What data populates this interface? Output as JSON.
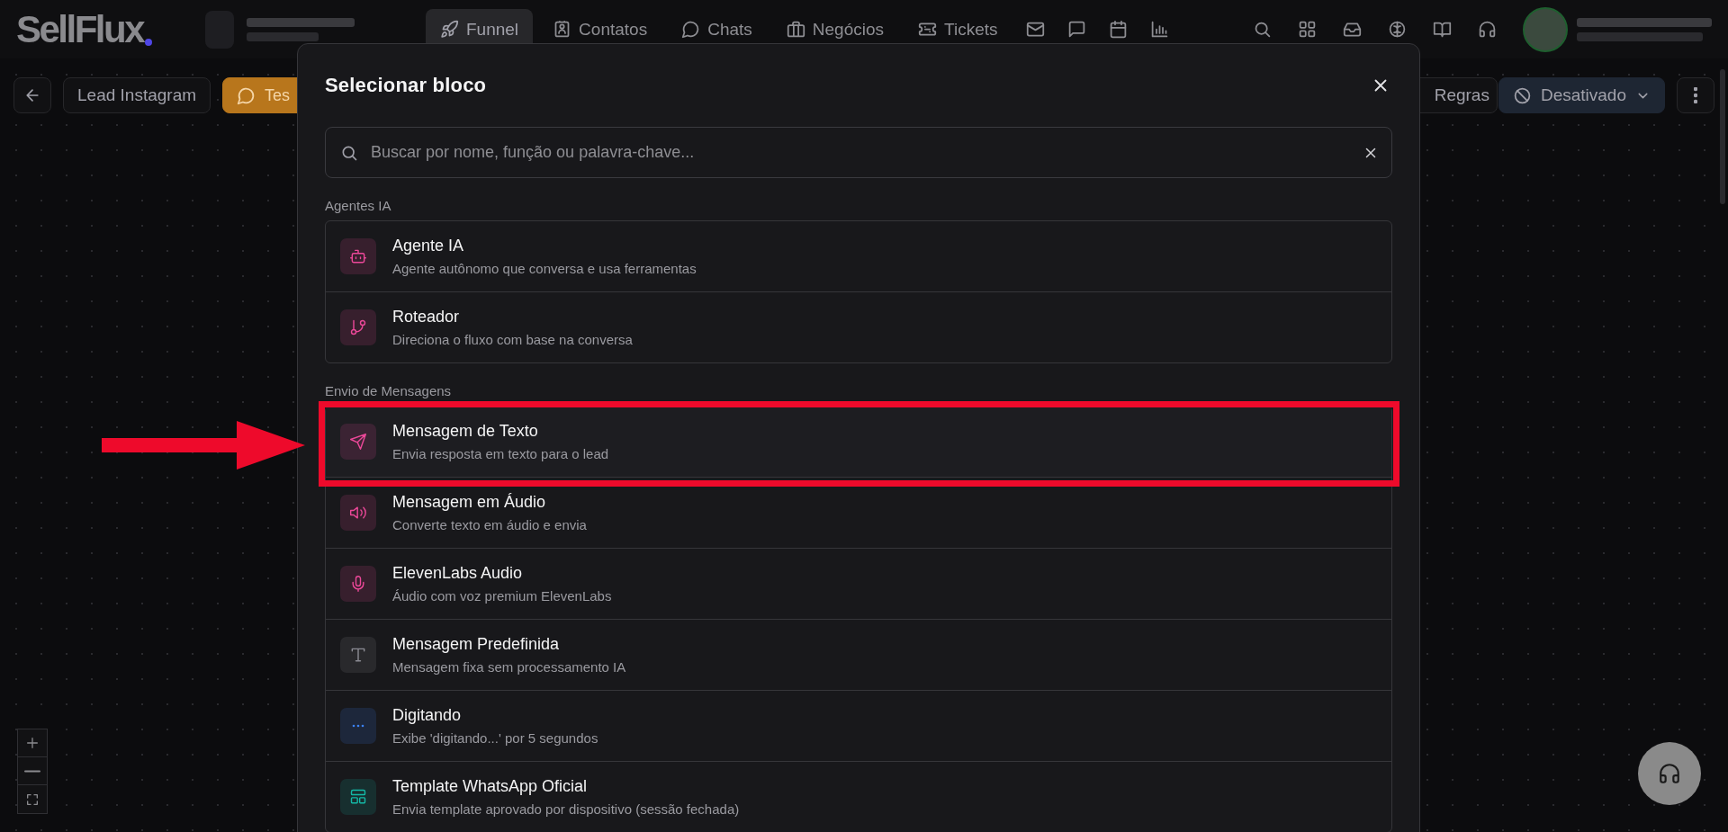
{
  "logo": {
    "text": "SellFlux"
  },
  "nav": [
    {
      "label": "Funnel",
      "kind": "rocket",
      "selected": true
    },
    {
      "label": "Contatos",
      "kind": "contact",
      "selected": false
    },
    {
      "label": "Chats",
      "kind": "chat",
      "selected": false
    },
    {
      "label": "Negócios",
      "kind": "briefcase",
      "selected": false
    },
    {
      "label": "Tickets",
      "kind": "ticket",
      "selected": false
    }
  ],
  "toolbar": {
    "flow_name": "Lead Instagram",
    "test_label": "Tes",
    "rules": "Regras",
    "status": "Desativado"
  },
  "modal": {
    "title": "Selecionar bloco",
    "search_placeholder": "Buscar por nome, função ou palavra-chave...",
    "groups": [
      {
        "label": "Agentes IA",
        "items": [
          {
            "title": "Agente IA",
            "description": "Agente autônomo que conversa e usa ferramentas",
            "kind": "robot",
            "color": "#ec4899",
            "selected": false
          },
          {
            "title": "Roteador",
            "description": "Direciona o fluxo com base na conversa",
            "kind": "branch",
            "color": "#ec4899",
            "selected": false
          }
        ]
      },
      {
        "label": "Envio de Mensagens",
        "items": [
          {
            "title": "Mensagem de Texto",
            "description": "Envia resposta em texto para o lead",
            "kind": "send",
            "color": "#ec4899",
            "selected": true
          },
          {
            "title": "Mensagem em Áudio",
            "description": "Converte texto em áudio e envia",
            "kind": "speaker",
            "color": "#ec4899",
            "selected": false
          },
          {
            "title": "ElevenLabs Audio",
            "description": "Áudio com voz premium ElevenLabs",
            "kind": "mic",
            "color": "#ec4899",
            "selected": false
          },
          {
            "title": "Mensagem Predefinida",
            "description": "Mensagem fixa sem processamento IA",
            "kind": "text",
            "color": "#8b8b93",
            "selected": false
          },
          {
            "title": "Digitando",
            "description": "Exibe 'digitando...' por 5 segundos",
            "kind": "typing",
            "color": "#3b82f6",
            "selected": false
          },
          {
            "title": "Template WhatsApp Oficial",
            "description": "Envia template aprovado por dispositivo (sessão fechada)",
            "kind": "template",
            "color": "#14b8a6",
            "selected": false
          }
        ]
      }
    ]
  }
}
